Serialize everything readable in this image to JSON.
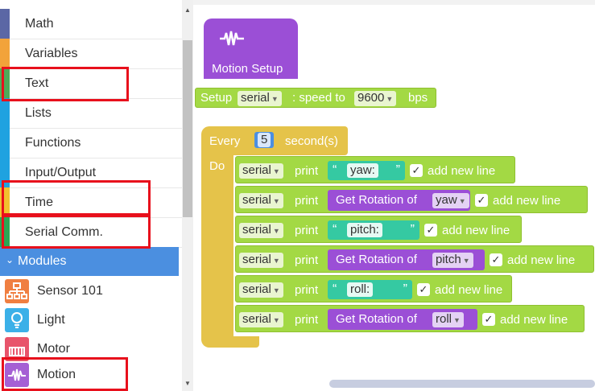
{
  "sidebar": {
    "categories": [
      {
        "label": "Math",
        "color": "#5b67a5"
      },
      {
        "label": "Variables",
        "color": "#f2a33a"
      },
      {
        "label": "Text",
        "color": "#4dab59"
      },
      {
        "label": "Lists",
        "color": "#1fa2e0"
      },
      {
        "label": "Functions",
        "color": "#1fa2e0"
      },
      {
        "label": "Input/Output",
        "color": "#1fa2e0"
      },
      {
        "label": "Time",
        "color": "#f2c12e"
      },
      {
        "label": "Serial Comm.",
        "color": "#2aa854"
      }
    ],
    "modules_header": "Modules",
    "modules": [
      {
        "label": "Sensor 101",
        "color": "#f07f41",
        "icon": "sensor-network-icon"
      },
      {
        "label": "Light",
        "color": "#3bb0e8",
        "icon": "lightbulb-icon"
      },
      {
        "label": "Motor",
        "color": "#e8546b",
        "icon": "motor-icon"
      },
      {
        "label": "Motion",
        "color": "#a55fd4",
        "icon": "motion-wave-icon"
      }
    ]
  },
  "workspace": {
    "motion_setup_label": "Motion Setup",
    "setup": {
      "prefix": "Setup",
      "port": "serial",
      "speed_label": ": speed to",
      "baud": "9600",
      "unit": "bps"
    },
    "every": {
      "label": "Every",
      "value": "5",
      "unit": "second(s)",
      "do_label": "Do"
    },
    "print_rows": [
      {
        "port": "serial",
        "print": "print",
        "kind": "text",
        "value": "yaw:",
        "newline": "add new line"
      },
      {
        "port": "serial",
        "print": "print",
        "kind": "rotation",
        "value": "yaw",
        "prefix": "Get Rotation of",
        "newline": "add new line"
      },
      {
        "port": "serial",
        "print": "print",
        "kind": "text",
        "value": "pitch:",
        "newline": "add new line"
      },
      {
        "port": "serial",
        "print": "print",
        "kind": "rotation",
        "value": "pitch",
        "prefix": "Get Rotation of",
        "newline": "add new line"
      },
      {
        "port": "serial",
        "print": "print",
        "kind": "text",
        "value": "roll:",
        "newline": "add new line"
      },
      {
        "port": "serial",
        "print": "print",
        "kind": "rotation",
        "value": "roll",
        "prefix": "Get Rotation of",
        "newline": "add new line"
      }
    ]
  },
  "colors": {
    "lime": "#a3d944",
    "yellow": "#e5c34a",
    "purple": "#9b4fd6",
    "teal": "#35c9a2",
    "blue": "#4b8fe0",
    "highlight": "#e8101c"
  }
}
